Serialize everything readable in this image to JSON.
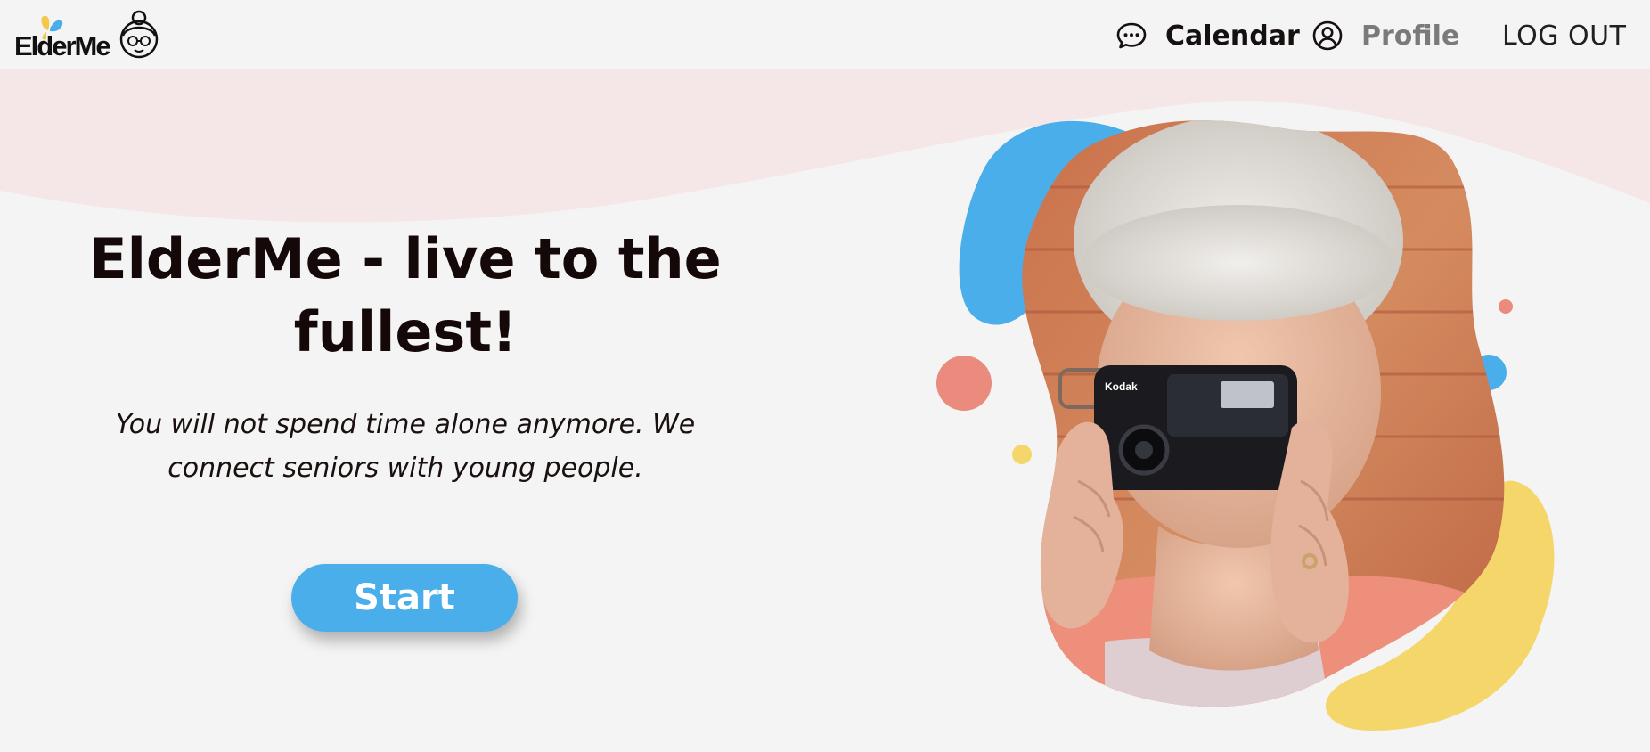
{
  "header": {
    "logo_text": "ElderMe",
    "nav": {
      "calendar": "Calendar",
      "profile": "Profile",
      "logout": "LOG OUT"
    }
  },
  "hero": {
    "title": "ElderMe - live to the fullest!",
    "subtitle": "You will not spend time alone anymore. We connect seniors with young people.",
    "start_button": "Start"
  },
  "icons": {
    "calendar": "chat-bubble-icon",
    "profile": "user-circle-icon",
    "logo": "grandma-face-icon"
  },
  "colors": {
    "accent_blue": "#4aaeeb",
    "accent_yellow": "#f5d66a",
    "accent_coral": "#ea8b7d",
    "wave_pink": "#f5e7e7",
    "background": "#f4f4f4",
    "text_dark": "#140808",
    "nav_muted": "#7a7a7a"
  }
}
